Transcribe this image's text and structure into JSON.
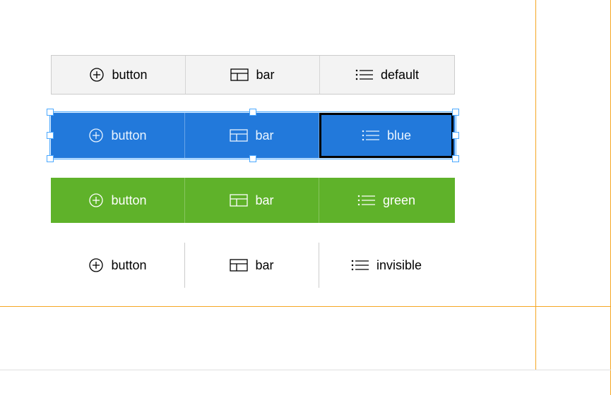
{
  "groups": [
    {
      "style": "default",
      "cells": [
        {
          "icon": "plus-circle",
          "label": "button"
        },
        {
          "icon": "layout",
          "label": "bar"
        },
        {
          "icon": "list",
          "label": "default"
        }
      ]
    },
    {
      "style": "blue",
      "cells": [
        {
          "icon": "plus-circle",
          "label": "button"
        },
        {
          "icon": "layout",
          "label": "bar"
        },
        {
          "icon": "list",
          "label": "blue"
        }
      ],
      "selected": true
    },
    {
      "style": "green",
      "cells": [
        {
          "icon": "plus-circle",
          "label": "button"
        },
        {
          "icon": "layout",
          "label": "bar"
        },
        {
          "icon": "list",
          "label": "green"
        }
      ]
    },
    {
      "style": "invisible",
      "cells": [
        {
          "icon": "plus-circle",
          "label": "button"
        },
        {
          "icon": "layout",
          "label": "bar"
        },
        {
          "icon": "list",
          "label": "invisible"
        }
      ]
    }
  ]
}
